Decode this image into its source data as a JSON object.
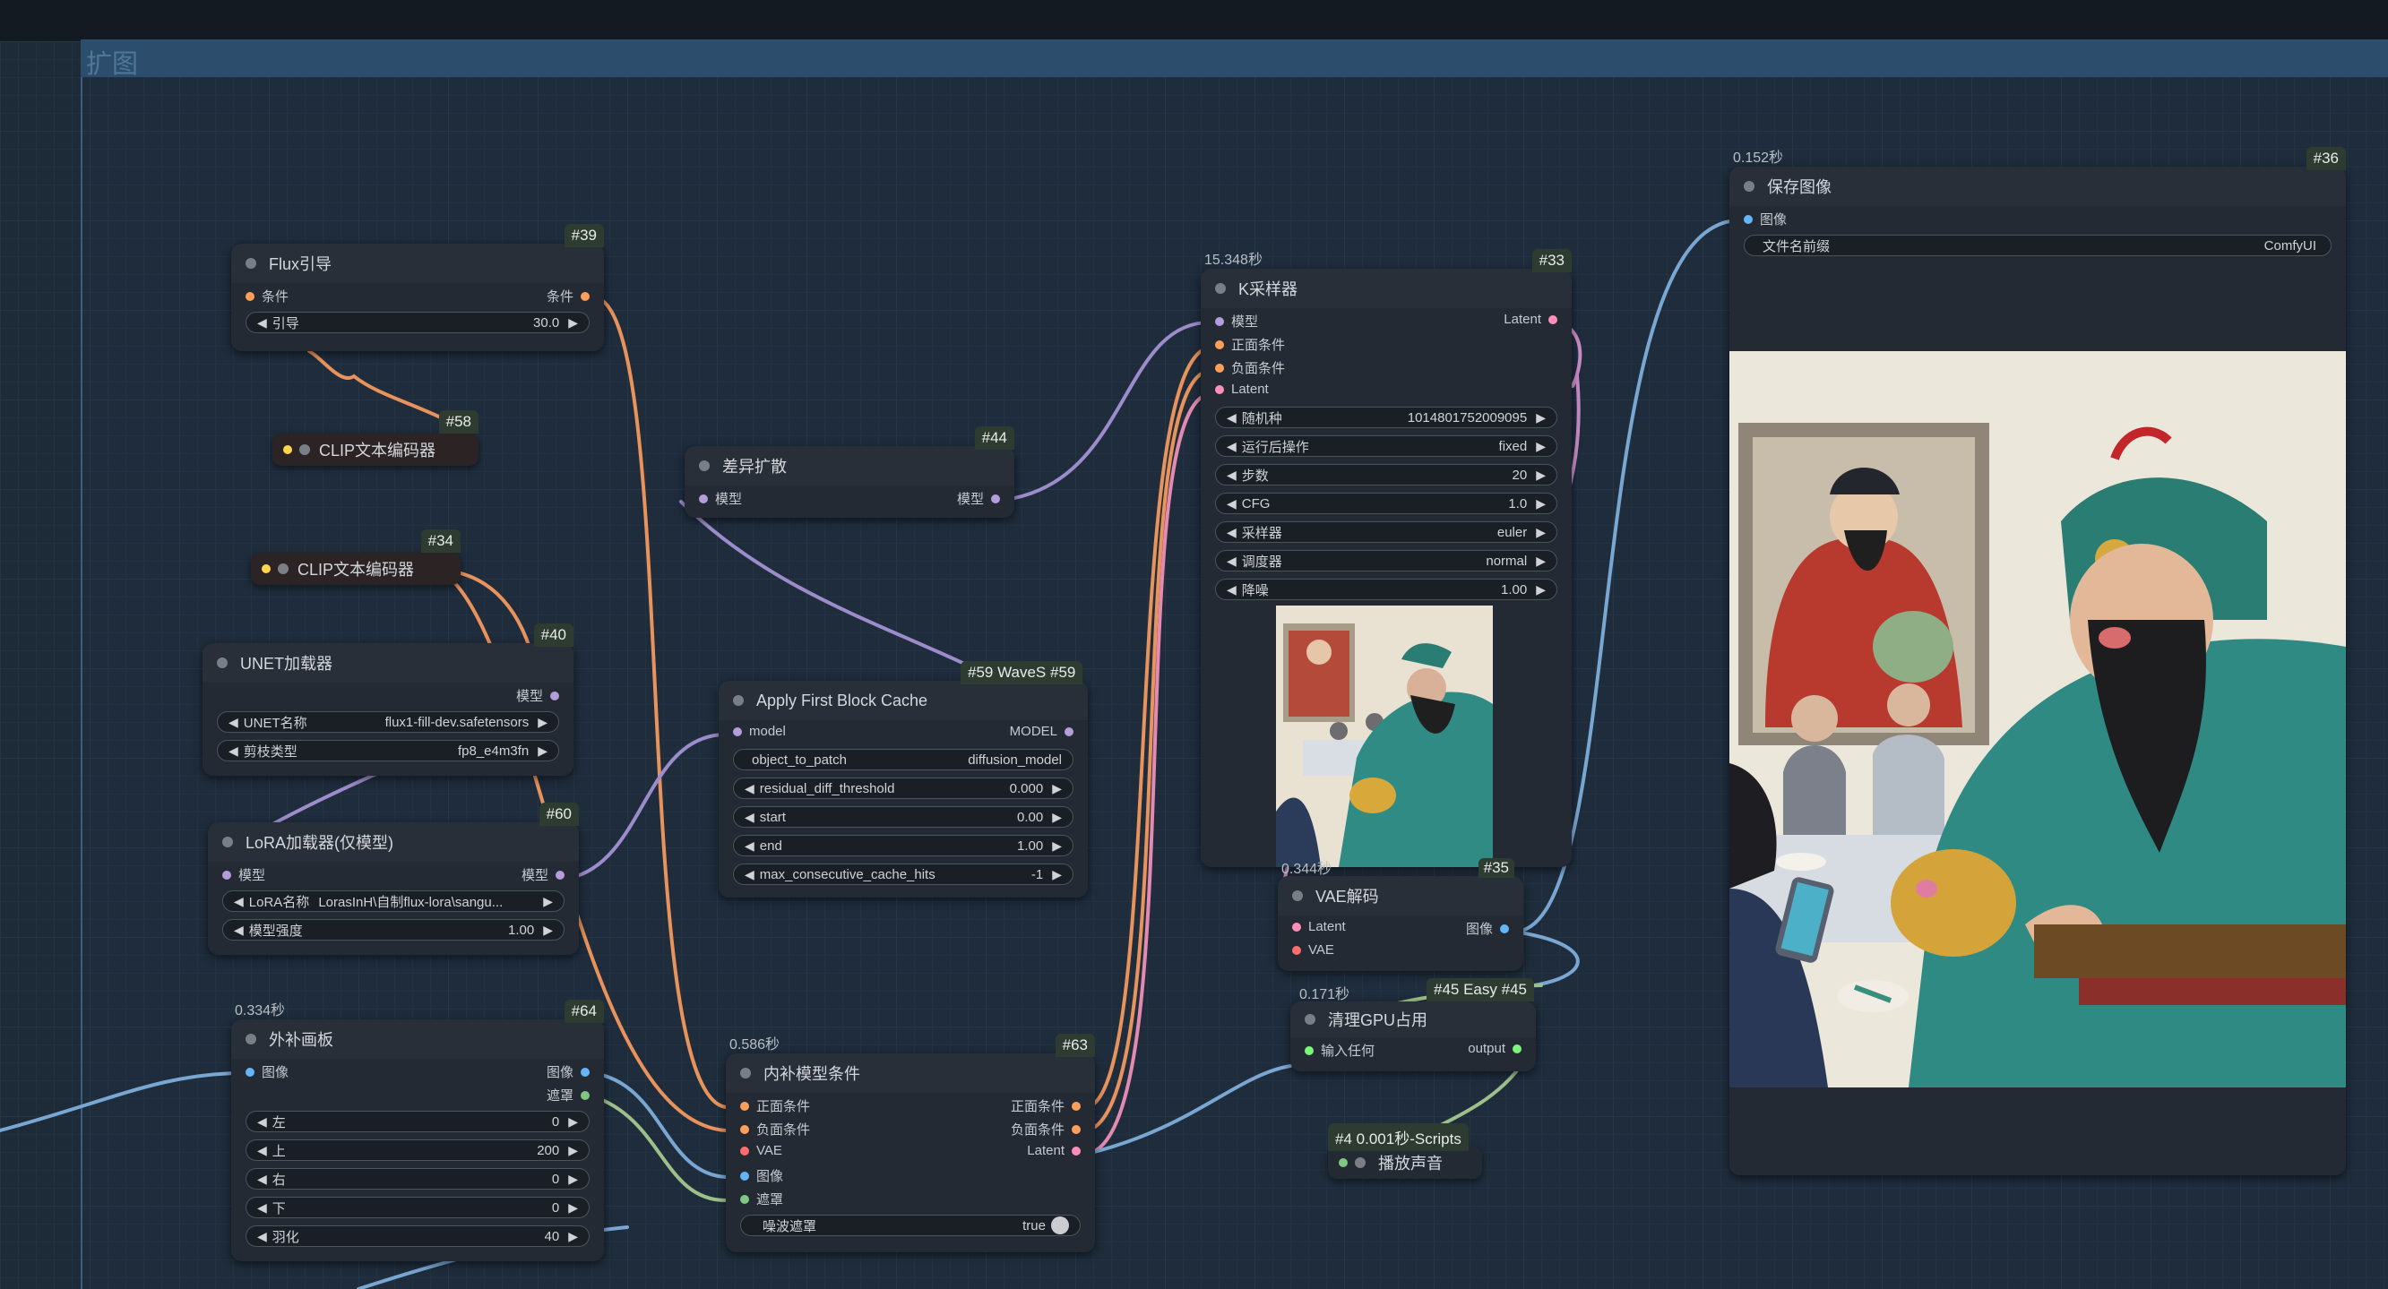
{
  "group": {
    "title": "扩图"
  },
  "colors": {
    "condition": "#ff9f5a",
    "model": "#b39ddb",
    "latent": "#ff8fb8",
    "vae": "#ff6e6e",
    "image": "#64b5f6",
    "mask": "#81c784",
    "clip": "#ffd54f",
    "node_id_bg": "#2d3b31"
  },
  "flux_guidance": {
    "id": "#39",
    "title": "Flux引导",
    "input": "条件",
    "output": "条件",
    "widget": {
      "label": "引导",
      "value": "30.0"
    }
  },
  "clip58": {
    "id": "#58",
    "title": "CLIP文本编码器"
  },
  "clip34": {
    "id": "#34",
    "title": "CLIP文本编码器"
  },
  "unet": {
    "id": "#40",
    "title": "UNET加载器",
    "output": "模型",
    "widgets": [
      {
        "label": "UNET名称",
        "value": "flux1-fill-dev.safetensors"
      },
      {
        "label": "剪枝类型",
        "value": "fp8_e4m3fn"
      }
    ]
  },
  "lora": {
    "id": "#60",
    "title": "LoRA加载器(仅模型)",
    "input": "模型",
    "output": "模型",
    "widgets": [
      {
        "label": "LoRA名称",
        "value": "LorasInH\\自制flux-lora\\sangu..."
      },
      {
        "label": "模型强度",
        "value": "1.00"
      }
    ]
  },
  "pad": {
    "id": "#64",
    "time": "0.334秒",
    "title": "外补画板",
    "input": "图像",
    "outputs": [
      "图像",
      "遮罩"
    ],
    "widgets": [
      {
        "label": "左",
        "value": "0"
      },
      {
        "label": "上",
        "value": "200"
      },
      {
        "label": "右",
        "value": "0"
      },
      {
        "label": "下",
        "value": "0"
      },
      {
        "label": "羽化",
        "value": "40"
      }
    ]
  },
  "diff": {
    "id": "#44",
    "title": "差异扩散",
    "input": "模型",
    "output": "模型"
  },
  "fbc": {
    "id": "#59",
    "badge": "#59 WaveS",
    "title": "Apply First Block Cache",
    "input": "model",
    "output": "MODEL",
    "widgets": [
      {
        "label": "object_to_patch",
        "value": "diffusion_model"
      },
      {
        "label": "residual_diff_threshold",
        "value": "0.000"
      },
      {
        "label": "start",
        "value": "0.00"
      },
      {
        "label": "end",
        "value": "1.00"
      },
      {
        "label": "max_consecutive_cache_hits",
        "value": "-1"
      }
    ]
  },
  "inpaint": {
    "id": "#63",
    "time": "0.586秒",
    "title": "内补模型条件",
    "inputs": [
      "正面条件",
      "负面条件",
      "VAE",
      "图像",
      "遮罩"
    ],
    "outputs": [
      "正面条件",
      "负面条件",
      "Latent"
    ],
    "toggle": {
      "label": "噪波遮罩",
      "value": "true"
    }
  },
  "ksampler": {
    "id": "#33",
    "time": "15.348秒",
    "title": "K采样器",
    "inputs": [
      "模型",
      "正面条件",
      "负面条件",
      "Latent"
    ],
    "output": "Latent",
    "widgets": [
      {
        "label": "随机种",
        "value": "1014801752009095"
      },
      {
        "label": "运行后操作",
        "value": "fixed"
      },
      {
        "label": "步数",
        "value": "20"
      },
      {
        "label": "CFG",
        "value": "1.0"
      },
      {
        "label": "采样器",
        "value": "euler"
      },
      {
        "label": "调度器",
        "value": "normal"
      },
      {
        "label": "降噪",
        "value": "1.00"
      }
    ]
  },
  "vaedecode": {
    "id": "#35",
    "time": "0.344秒",
    "title": "VAE解码",
    "inputs": [
      "Latent",
      "VAE"
    ],
    "output": "图像"
  },
  "gpu": {
    "id": "#45",
    "time": "0.171秒",
    "badge": "#45 Easy",
    "title": "清理GPU占用",
    "input": "输入任何",
    "output": "output"
  },
  "sound": {
    "id": "#4",
    "time": "0.001秒",
    "badge": "-Scripts",
    "title": "播放声音"
  },
  "save": {
    "id": "#36",
    "time": "0.152秒",
    "title": "保存图像",
    "input": "图像",
    "widget": {
      "label": "文件名前缀",
      "value": "ComfyUI"
    }
  }
}
